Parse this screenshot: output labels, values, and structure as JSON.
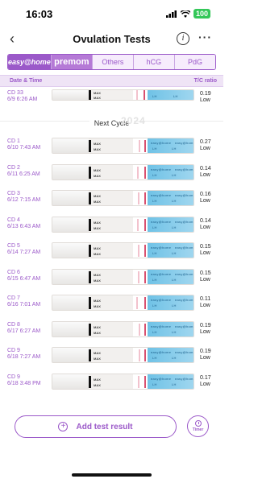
{
  "status": {
    "time": "16:03",
    "battery": "100"
  },
  "nav": {
    "title": "Ovulation Tests",
    "info_glyph": "i",
    "more_glyph": "···",
    "back_glyph": "‹"
  },
  "brand_tabs": [
    {
      "label": "easy@home",
      "active": true
    },
    {
      "label": "premom",
      "active": false
    },
    {
      "label": "Others",
      "active": false
    },
    {
      "label": "hCG",
      "active": false
    },
    {
      "label": "PdG",
      "active": false
    }
  ],
  "columns": {
    "date_time": "Date & Time",
    "tc_ratio": "T/C ratio"
  },
  "previous_row": {
    "cd": "CD 33",
    "date": "6/9 6:26 AM",
    "ratio": "0.19",
    "result": "Low"
  },
  "cycle_separator": "Next Cycle",
  "watermark": "2024",
  "strip_text": {
    "max": "MAX",
    "lh": "LH",
    "brand": "easy@home"
  },
  "rows": [
    {
      "cd": "CD 1",
      "date": "6/10 7:43 AM",
      "ratio": "0.27",
      "result": "Low"
    },
    {
      "cd": "CD 2",
      "date": "6/11 6:25 AM",
      "ratio": "0.14",
      "result": "Low"
    },
    {
      "cd": "CD 3",
      "date": "6/12 7:15 AM",
      "ratio": "0.16",
      "result": "Low"
    },
    {
      "cd": "CD 4",
      "date": "6/13 6:43 AM",
      "ratio": "0.14",
      "result": "Low"
    },
    {
      "cd": "CD 5",
      "date": "6/14 7:27 AM",
      "ratio": "0.15",
      "result": "Low"
    },
    {
      "cd": "CD 6",
      "date": "6/15 6:47 AM",
      "ratio": "0.15",
      "result": "Low"
    },
    {
      "cd": "CD 7",
      "date": "6/16 7:01 AM",
      "ratio": "0.11",
      "result": "Low"
    },
    {
      "cd": "CD 8",
      "date": "6/17 6:27 AM",
      "ratio": "0.19",
      "result": "Low"
    },
    {
      "cd": "CD 9",
      "date": "6/18 7:27 AM",
      "ratio": "0.19",
      "result": "Low"
    },
    {
      "cd": "CD 9",
      "date": "6/18 3:48 PM",
      "ratio": "0.17",
      "result": "Low"
    }
  ],
  "actions": {
    "add_label": "Add test result",
    "add_icon": "+",
    "timer_label": "Timer"
  },
  "colors": {
    "accent": "#9b59c9",
    "strip_blue": "#6fc2e6",
    "test_line": "#d9506f"
  }
}
